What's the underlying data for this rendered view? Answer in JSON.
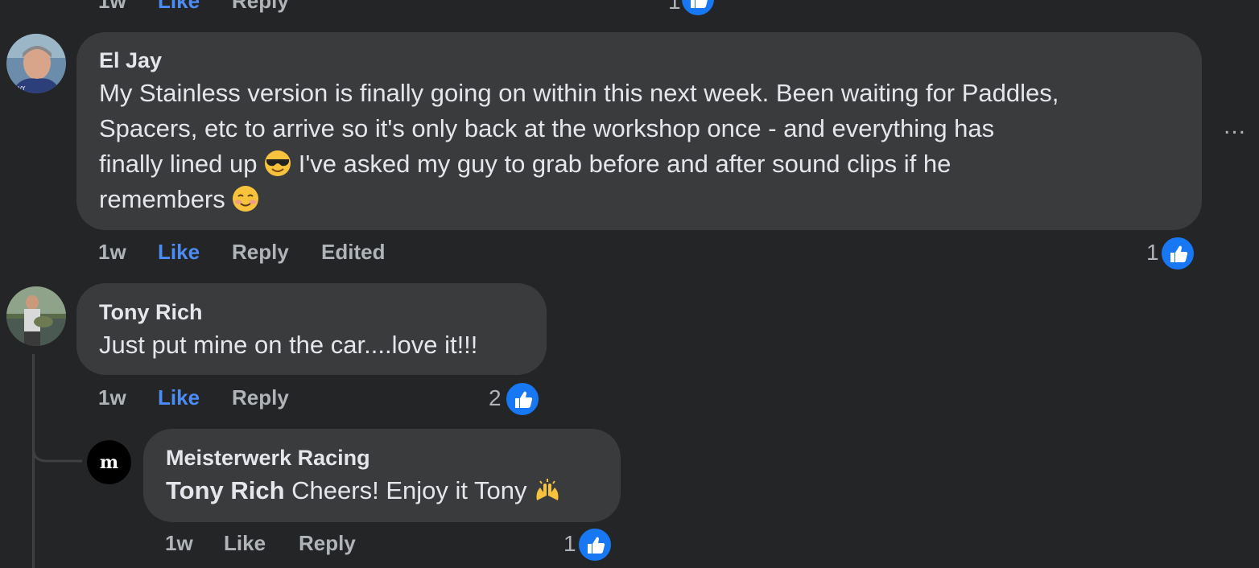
{
  "top_partial": {
    "time": "1w",
    "like": "Like",
    "reply": "Reply",
    "count": "1"
  },
  "comments": [
    {
      "author": "El Jay",
      "lines": [
        "My Stainless version is finally going on within this next week. Been waiting for Paddles,",
        "Spacers, etc to arrive so it's only back at the workshop once - and everything has",
        "finally lined up",
        "I've asked my guy to grab before and after sound clips if he",
        "remembers"
      ],
      "time": "1w",
      "like": "Like",
      "reply": "Reply",
      "edited": "Edited",
      "reaction_count": "1",
      "more": "..."
    },
    {
      "author": "Tony Rich",
      "text": "Just put mine on the car....love it!!!",
      "time": "1w",
      "like": "Like",
      "reply": "Reply",
      "reaction_count": "2"
    },
    {
      "author": "Meisterwerk Racing",
      "mention": "Tony Rich",
      "text": "Cheers! Enjoy it Tony",
      "time": "1w",
      "like": "Like",
      "reply": "Reply",
      "reaction_count": "1"
    }
  ],
  "icons": {
    "like_reaction": "thumbs-up-icon",
    "sunglasses_emoji": "sunglasses-emoji-icon",
    "smiling_emoji": "smiling-face-emoji-icon",
    "raising_hands_emoji": "raising-hands-emoji-icon"
  },
  "colors": {
    "background": "#242526",
    "bubble": "#3a3b3c",
    "text": "#e4e6eb",
    "secondary": "#b0b3b8",
    "like_active": "#4b8cf7",
    "like_badge": "#1877f2"
  }
}
